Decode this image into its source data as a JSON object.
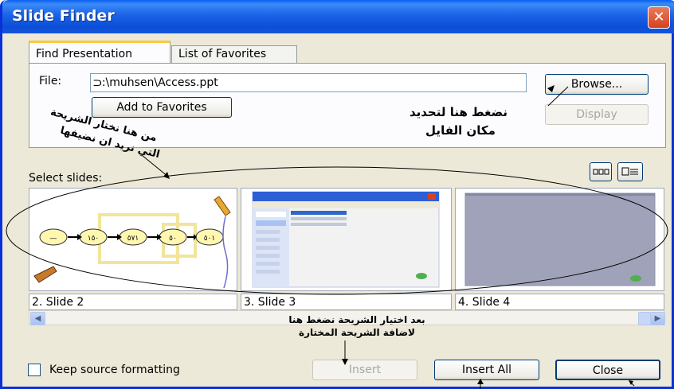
{
  "window": {
    "title": "Slide Finder",
    "close_glyph": "✕"
  },
  "tabs": [
    {
      "label": "Find Presentation",
      "active": true
    },
    {
      "label": "List of Favorites",
      "active": false
    }
  ],
  "file": {
    "label": "File:",
    "value": "ﬤ:\\muhsen\\Access.ppt"
  },
  "buttons": {
    "add_favorites": "Add to Favorites",
    "browse": "Browse...",
    "display": "Display",
    "insert": "Insert",
    "insert_all": "Insert All",
    "close": "Close"
  },
  "select_slides_label": "Select slides:",
  "slides": [
    {
      "caption": "2. Slide 2",
      "badges": [
        "—",
        "١٥٠",
        "٥٧١",
        "٥٠",
        "٥٠١"
      ]
    },
    {
      "caption": "3. Slide 3"
    },
    {
      "caption": "4. Slide 4"
    }
  ],
  "keep_source_label": "Keep source formatting",
  "annotations": {
    "browse_note_line1": "نضغط هنا لتحديد",
    "browse_note_line2": "مكان الفايل",
    "select_note_line1": "من هنا نختار الشريحة",
    "select_note_line2": "التي نريد ان نضيفها",
    "insert_note_line1": "بعد اختيار الشريحة نضغط هنا",
    "insert_note_line2": "لاضافة الشريحة المختارة"
  },
  "colors": {
    "titlebar": "#0B4FD8",
    "dialog_bg": "#ECE9D8",
    "tab_highlight": "#FFC83C",
    "close_red": "#D4431E"
  }
}
